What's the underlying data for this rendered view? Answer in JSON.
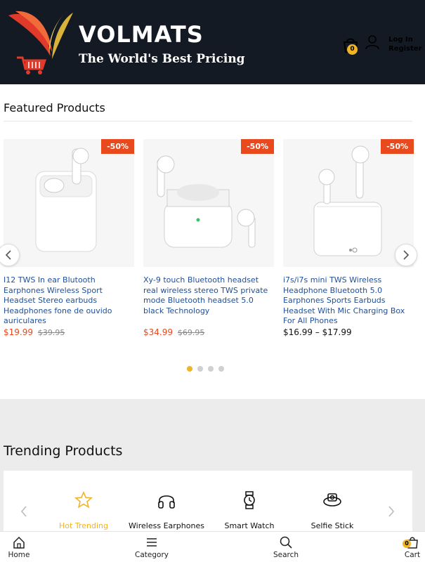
{
  "header": {
    "brand_name": "VOLMATS",
    "tagline": "The World's Best Pricing",
    "cart_count": "0",
    "login_label": "Log In",
    "register_label": "Register"
  },
  "featured": {
    "title": "Featured Products",
    "products": [
      {
        "discount": "-50%",
        "title": "I12 TWS In ear Blutooth Earphones Wireless Sport Headset Stereo earbuds Headphones fone de ouvido auriculares",
        "price": "$19.99",
        "old_price": "$39.95"
      },
      {
        "discount": "-50%",
        "title": "Xy-9 touch Bluetooth headset real wireless stereo TWS private mode Bluetooth headset 5.0 black Technology",
        "price": "$34.99",
        "old_price": "$69.95"
      },
      {
        "discount": "-50%",
        "title": "i7s/i7s mini TWS Wireless Headphone Bluetooth 5.0 Earphones Sports Earbuds Headset With Mic Charging Box For All Phones",
        "price_range": "$16.99 – $17.99"
      }
    ],
    "carousel_pages": 4,
    "active_page": 1
  },
  "trending": {
    "title": "Trending Products",
    "categories": [
      {
        "label": "Hot Trending",
        "icon": "star-icon",
        "active": true
      },
      {
        "label": "Wireless Earphones",
        "icon": "headphones-icon",
        "active": false
      },
      {
        "label": "Smart Watch",
        "icon": "smartwatch-icon",
        "active": false
      },
      {
        "label": "Selfie Stick",
        "icon": "camera-icon",
        "active": false
      }
    ]
  },
  "bottom_nav": {
    "home": "Home",
    "category": "Category",
    "search": "Search",
    "cart": "Cart",
    "cart_count": "0"
  },
  "colors": {
    "header_bg": "#141a24",
    "accent": "#f0b429",
    "sale": "#e8491d",
    "link": "#1f4f99"
  }
}
